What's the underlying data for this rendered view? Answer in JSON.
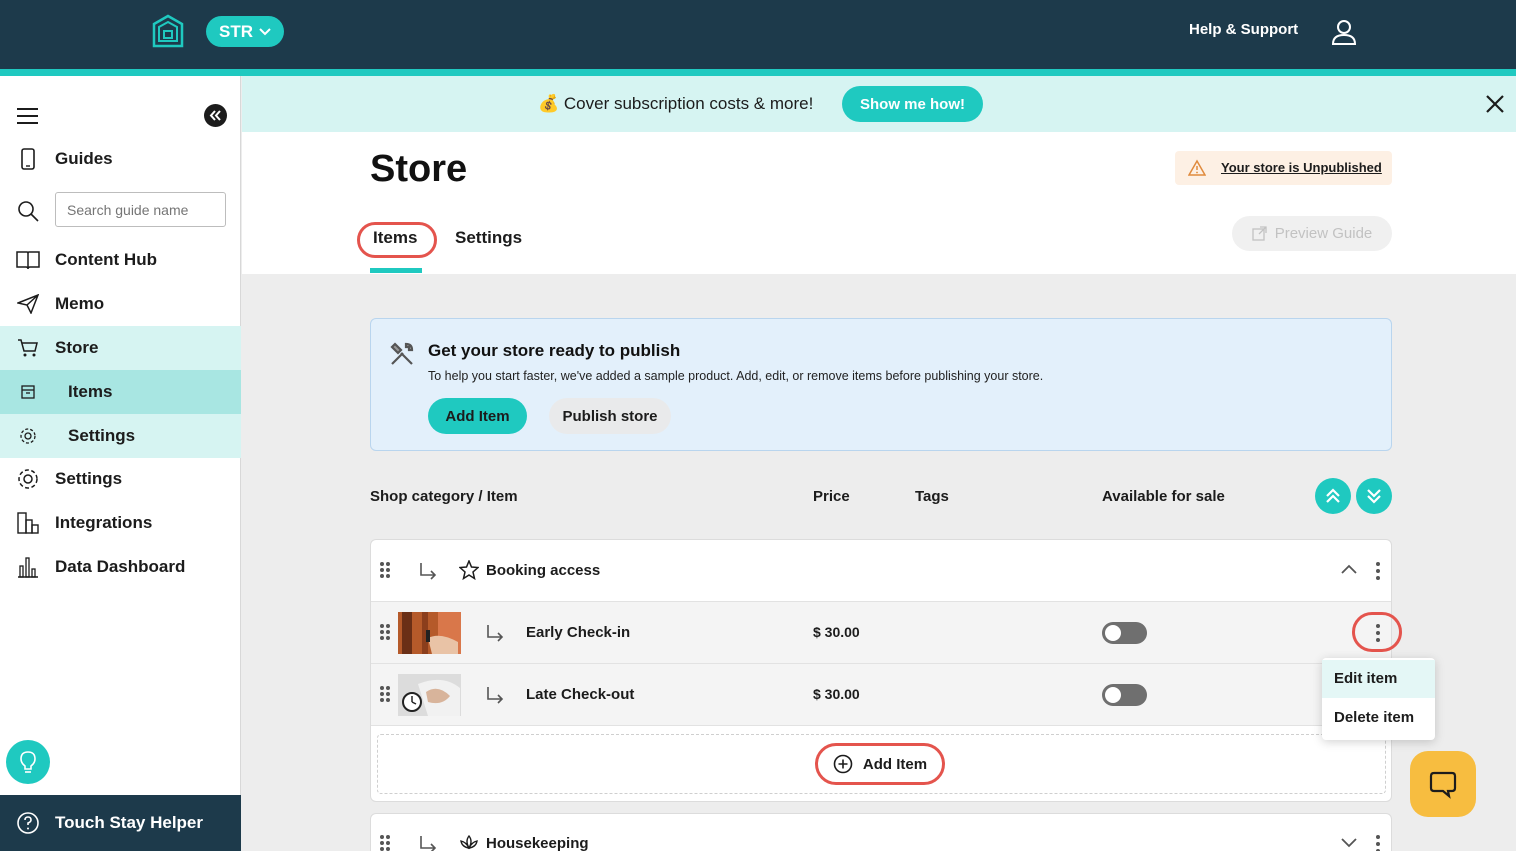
{
  "topbar": {
    "org_label": "STR",
    "help_label": "Help & Support"
  },
  "banner": {
    "text": "💰 Cover subscription costs & more!",
    "cta_label": "Show me how!"
  },
  "sidebar": {
    "search_placeholder": "Search guide name",
    "items": [
      {
        "label": "Guides",
        "icon": "phone-icon"
      },
      {
        "label": "Content Hub",
        "icon": "book-icon"
      },
      {
        "label": "Memo",
        "icon": "send-icon"
      },
      {
        "label": "Store",
        "icon": "cart-icon"
      },
      {
        "label": "Items",
        "icon": "box-icon"
      },
      {
        "label": "Settings",
        "icon": "gear-icon"
      },
      {
        "label": "Settings",
        "icon": "gear-icon"
      },
      {
        "label": "Integrations",
        "icon": "integrations-icon"
      },
      {
        "label": "Data Dashboard",
        "icon": "bar-chart-icon"
      }
    ],
    "helper_label": "Touch Stay Helper"
  },
  "page": {
    "title": "Store",
    "unpublished_label": "Your store is Unpublished",
    "tabs": [
      "Items",
      "Settings"
    ],
    "preview_label": "Preview Guide"
  },
  "info": {
    "title": "Get your store ready to publish",
    "description": "To help you start faster, we've added a sample product. Add, edit, or remove items before publishing your store.",
    "add_label": "Add Item",
    "publish_label": "Publish store"
  },
  "table": {
    "headers": [
      "Shop category / Item",
      "Price",
      "Tags",
      "Available for sale"
    ]
  },
  "categories": [
    {
      "name": "Booking access",
      "items": [
        {
          "name": "Early Check-in",
          "price": "$ 30.00",
          "available": false
        },
        {
          "name": "Late Check-out",
          "price": "$ 30.00",
          "available": false
        }
      ],
      "add_label": "Add Item"
    },
    {
      "name": "Housekeeping"
    }
  ],
  "context_menu": {
    "items": [
      "Edit item",
      "Delete item"
    ]
  },
  "colors": {
    "brand_dark": "#1d3a4b",
    "brand_teal": "#1fc9c0",
    "highlight_ring": "#e4544d",
    "chat_yellow": "#f7bd40"
  }
}
